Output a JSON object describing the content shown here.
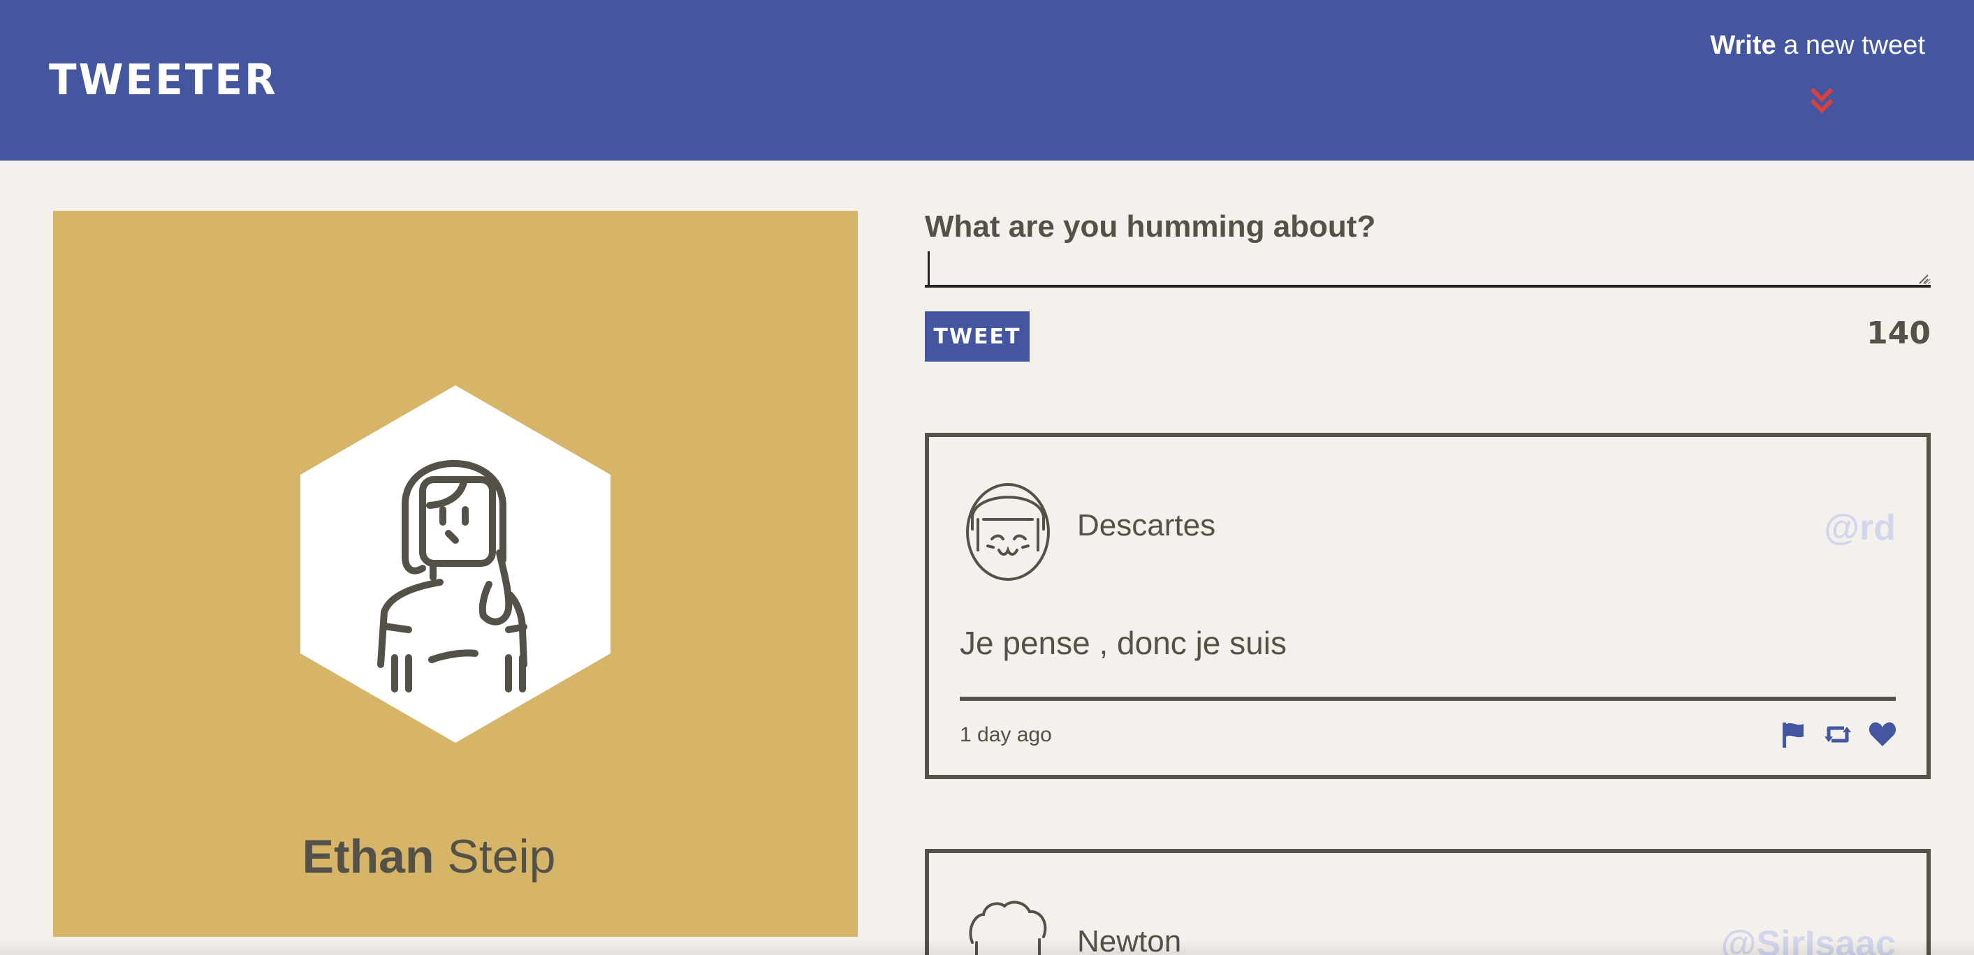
{
  "nav": {
    "brand": "TWEETER",
    "compose_bold": "Write",
    "compose_rest": " a new tweet"
  },
  "profile": {
    "first_name": "Ethan",
    "last_name": " Steip"
  },
  "compose": {
    "label": "What are you humming about?",
    "value": "",
    "button_label": "TWEET",
    "counter": "140"
  },
  "tweets": [
    {
      "name": "Descartes",
      "handle": "@rd",
      "body": "Je pense , donc je suis",
      "time": "1 day ago"
    },
    {
      "name": "Newton",
      "handle": "@SirIsaac"
    }
  ],
  "icons": {
    "compose_toggle": "double-chevron-down-icon",
    "actions": [
      "flag-icon",
      "retweet-icon",
      "heart-icon"
    ]
  },
  "colors": {
    "nav_bg": "#4556a0",
    "page_bg": "#f4f1ec",
    "profile_bg": "#d6b568",
    "text": "#545149",
    "handle": "#d2d6ec",
    "accent_red": "#d9423c"
  }
}
